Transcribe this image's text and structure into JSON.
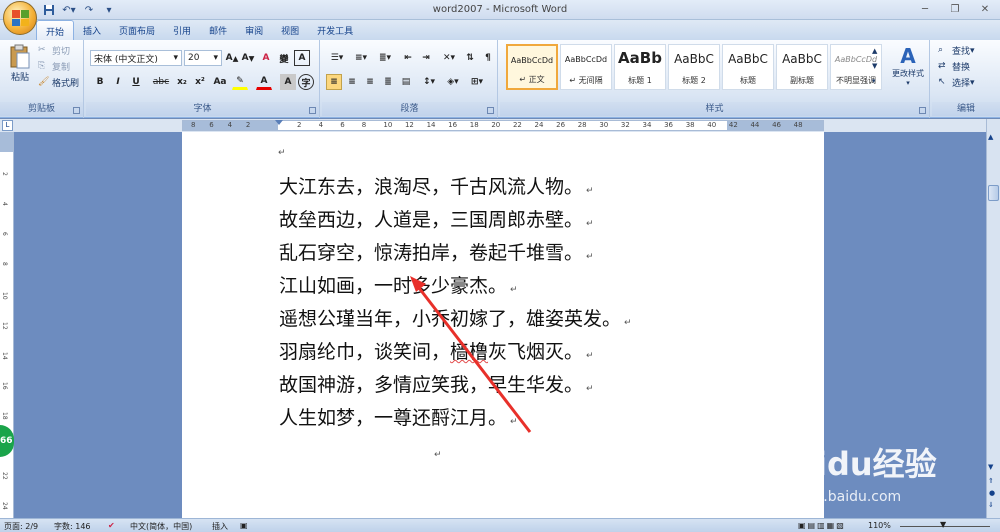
{
  "window": {
    "title": "word2007 - Microsoft Word"
  },
  "tabs": [
    "开始",
    "插入",
    "页面布局",
    "引用",
    "邮件",
    "审阅",
    "视图",
    "开发工具"
  ],
  "ribbon": {
    "clipboard": {
      "paste": "粘贴",
      "cut": "剪切",
      "copy": "复制",
      "format_painter": "格式刷",
      "label": "剪贴板"
    },
    "font": {
      "name": "宋体 (中文正文)",
      "size": "20",
      "label": "字体",
      "buttons": [
        "B",
        "I",
        "U",
        "abc",
        "x₂",
        "x²",
        "Aa"
      ],
      "highlight_color": "#ffff00",
      "font_color": "#e60000"
    },
    "paragraph": {
      "label": "段落"
    },
    "styles": {
      "label": "样式",
      "items": [
        {
          "sample": "AaBbCcDd",
          "name": "↵ 正文",
          "selected": true
        },
        {
          "sample": "AaBbCcDd",
          "name": "↵ 无间隔",
          "selected": false
        },
        {
          "sample": "AaBb",
          "name": "标题 1",
          "selected": false
        },
        {
          "sample": "AaBbC",
          "name": "标题 2",
          "selected": false
        },
        {
          "sample": "AaBbC",
          "name": "标题",
          "selected": false
        },
        {
          "sample": "AaBbC",
          "name": "副标题",
          "selected": false
        },
        {
          "sample": "AaBbCcDd",
          "name": "不明显强调",
          "selected": false
        }
      ],
      "change_styles": "更改样式"
    },
    "editing": {
      "find": "查找",
      "replace": "替换",
      "select": "选择",
      "label": "编辑"
    }
  },
  "ruler": {
    "h_left": [
      "8",
      "6",
      "4",
      "2"
    ],
    "h_right": [
      "2",
      "4",
      "6",
      "8",
      "10",
      "12",
      "14",
      "16",
      "18",
      "20",
      "22",
      "24",
      "26",
      "28",
      "30",
      "32",
      "34",
      "36",
      "38",
      "40",
      "42",
      "44",
      "46",
      "48"
    ],
    "v": [
      "2",
      "4",
      "6",
      "8",
      "10",
      "12",
      "14",
      "16",
      "18",
      "20",
      "22",
      "24"
    ]
  },
  "document": {
    "lines": [
      "大江东去，浪淘尽，千古风流人物。",
      "故垒西边，人道是，三国周郎赤壁。",
      "乱石穿空，惊涛拍岸，卷起千堆雪。",
      "江山如画，一时多少豪杰。",
      "遥想公瑾当年，小乔初嫁了，雄姿英发。",
      "羽扇纶巾，谈笑间，樯橹灰飞烟灭。",
      "故国神游，多情应笑我，早生华发。",
      "人生如梦，一尊还酹江月。"
    ],
    "paragraph_mark": "↵"
  },
  "status": {
    "page": "页面: 2/9",
    "words": "字数: 146",
    "language": "中文(简体，中国)",
    "mode": "插入",
    "zoom": "110%"
  },
  "watermark": {
    "brand": "Baidu经验",
    "url": "jingyan.baidu.com"
  },
  "side_badge": "66",
  "colors": {
    "accent_arrow": "#e8302a",
    "ribbon_border": "#8db2e3",
    "workspace": "#6d8cbf"
  }
}
